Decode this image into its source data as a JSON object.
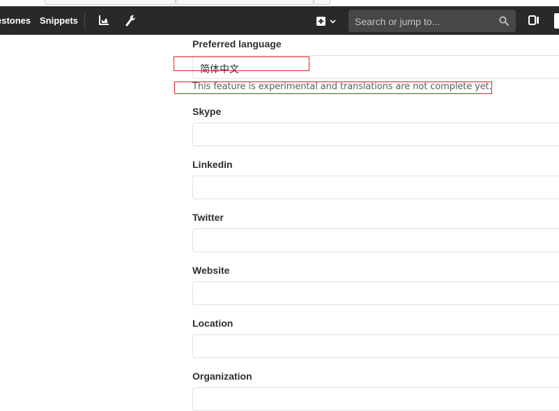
{
  "navbar": {
    "nav_links": [
      "estones",
      "Snippets"
    ],
    "icons": [
      "chart-icon",
      "wrench-icon",
      "plus-square-icon",
      "chevron-down-icon",
      "search-icon",
      "sidebar-panel-icon"
    ],
    "search": {
      "placeholder": "Search or jump to..."
    }
  },
  "form": {
    "preferred_language": {
      "label": "Preferred language",
      "value": "简体中文",
      "help": "This feature is experimental and translations are not complete yet."
    },
    "fields": [
      {
        "label": "Skype",
        "value": ""
      },
      {
        "label": "Linkedin",
        "value": ""
      },
      {
        "label": "Twitter",
        "value": ""
      },
      {
        "label": "Website",
        "value": ""
      },
      {
        "label": "Location",
        "value": ""
      },
      {
        "label": "Organization",
        "value": ""
      }
    ]
  },
  "colors": {
    "navbar_bg": "#292929",
    "search_bg": "#474747",
    "annotation_red": "#e02020",
    "input_border": "#e0e0e0"
  }
}
